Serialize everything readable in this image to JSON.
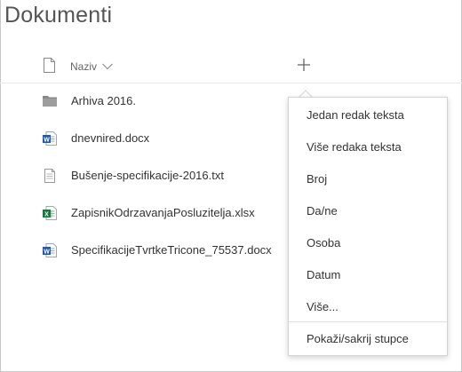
{
  "library": {
    "title": "Dokumenti"
  },
  "columns": {
    "name_header": "Naziv",
    "type_icon": "document-outline-icon",
    "sort_icon": "chevron-down-icon",
    "add_icon": "plus-icon"
  },
  "files": [
    {
      "name": "Arhiva 2016.",
      "icon": "folder-icon"
    },
    {
      "name": "dnevnired.docx",
      "icon": "word-file-icon"
    },
    {
      "name": "Bušenje-specifikacije-2016.txt",
      "icon": "text-file-icon"
    },
    {
      "name": "ZapisnikOdrzavanjaPosluzitelja.xlsx",
      "icon": "excel-file-icon"
    },
    {
      "name": "SpecifikacijeTvrtkeTricone_75537.docx",
      "icon": "word-file-icon"
    }
  ],
  "add_column_menu": {
    "items": [
      "Jedan redak teksta",
      "Više redaka teksta",
      "Broj",
      "Da/ne",
      "Osoba",
      "Datum",
      "Više..."
    ],
    "footer_item": "Pokaži/sakrij stupce"
  },
  "colors": {
    "word": "#2b579a",
    "excel": "#217346",
    "folder": "#8a8a8a",
    "text": "#333333"
  }
}
